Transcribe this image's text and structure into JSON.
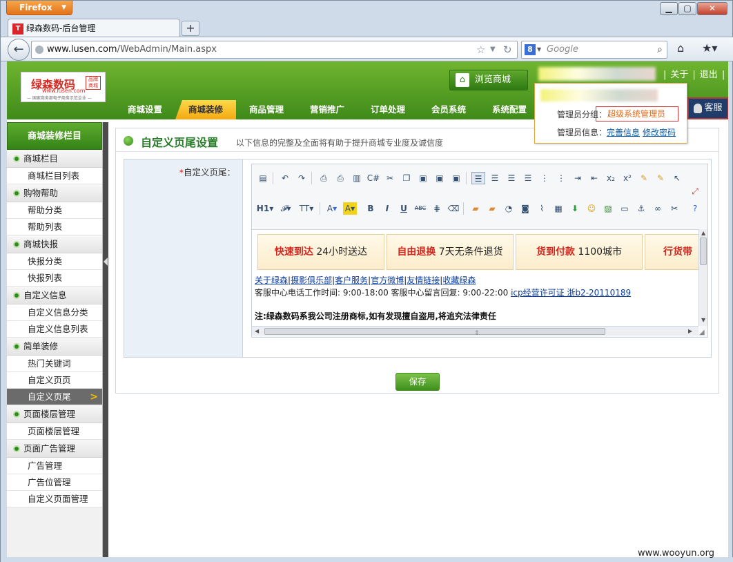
{
  "browser": {
    "app_button": "Firefox",
    "tab_title": "绿森数码-后台管理",
    "url_host": "www.lusen.com",
    "url_path": "/WebAdmin/Main.aspx",
    "search_placeholder": "Google"
  },
  "header": {
    "logo_name": "绿森数码",
    "logo_url": "www.lusen.com",
    "logo_tagline": "— 国家商务部电子商务示范企业 —",
    "logo_seal": "品牌商城",
    "browse_button": "浏览商城",
    "top_links": [
      "关于",
      "退出"
    ],
    "menu": [
      "商城设置",
      "商城装修",
      "商品管理",
      "营销推广",
      "订单处理",
      "会员系统",
      "系统配置"
    ],
    "active_menu": "商城装修",
    "kefu_button": "客服"
  },
  "admin_popup": {
    "group_label": "管理员分组：",
    "group_value": "超级系统管理员",
    "info_label": "管理员信息：",
    "link_complete": "完善信息",
    "link_password": "修改密码"
  },
  "sidebar": {
    "title": "商城装修栏目",
    "groups": [
      {
        "label": "商城栏目",
        "items": [
          "商城栏目列表"
        ]
      },
      {
        "label": "购物帮助",
        "items": [
          "帮助分类",
          "帮助列表"
        ]
      },
      {
        "label": "商城快报",
        "items": [
          "快报分类",
          "快报列表"
        ]
      },
      {
        "label": "自定义信息",
        "items": [
          "自定义信息分类",
          "自定义信息列表"
        ]
      },
      {
        "label": "简单装修",
        "items": [
          "热门关键词",
          "自定义页页",
          "自定义页尾"
        ]
      },
      {
        "label": "页面楼层管理",
        "items": [
          "页面楼层管理"
        ]
      },
      {
        "label": "页面广告管理",
        "items": [
          "广告管理",
          "广告位管理",
          "自定义页面管理"
        ]
      }
    ],
    "active_item": "自定义页尾"
  },
  "main": {
    "title": "自定义页尾设置",
    "subtitle": "以下信息的完整及全面将有助于提升商城专业度及诚信度",
    "field_required_mark": "*",
    "field_label": "自定义页尾：",
    "save_button": "保存"
  },
  "editor": {
    "promos": [
      {
        "em": "快速到达",
        "text": "24小时送达"
      },
      {
        "em": "自由退换",
        "text": "7天无条件退货"
      },
      {
        "em": "货到付款",
        "text": "1100城市"
      },
      {
        "em": "行货带",
        "text": ""
      }
    ],
    "footer_links": [
      "关于绿森",
      "摄影俱乐部",
      "客户服务",
      "官方微博",
      "友情链接",
      "收藏绿森"
    ],
    "service_text": "客服中心电话工作时间: 9:00-18:00 客服中心留言回复: 9:00-22:00",
    "icp_link": "icp经营许可证 浙b2-20110189",
    "notice": "注:绿森数码系我公司注册商标,如有发现擅自盗用,将追究法律责任",
    "toolbar_text": [
      "H1",
      "𝓕",
      "TT",
      "A",
      "A",
      "B",
      "I",
      "U",
      "ABC"
    ]
  },
  "watermark": "www.wooyun.org"
}
